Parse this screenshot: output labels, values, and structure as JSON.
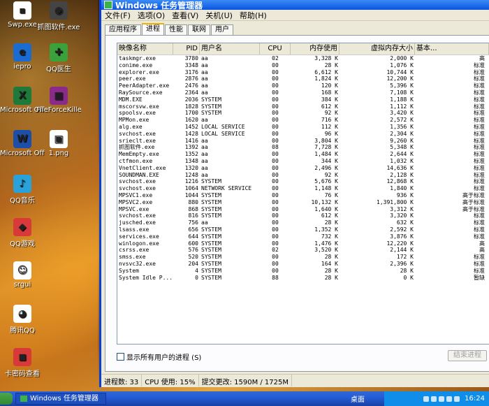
{
  "desktop_icons": [
    {
      "label": "Swp.exe",
      "color": "#ffffff",
      "glyph": "▪"
    },
    {
      "label": "抓图软件.exe",
      "color": "#444444",
      "glyph": "◉"
    },
    {
      "label": "iepro",
      "color": "#1a6cd0",
      "glyph": "e"
    },
    {
      "label": "QQ医生",
      "color": "#3ba23b",
      "glyph": "✚"
    },
    {
      "label": "Microsoft Office Ex...",
      "color": "#1d7a3a",
      "glyph": "X"
    },
    {
      "label": "FileForceKille...",
      "color": "#8a2a8a",
      "glyph": "▦"
    },
    {
      "label": "Microsoft Office W...",
      "color": "#1e4fa8",
      "glyph": "W"
    },
    {
      "label": "1.png",
      "color": "#ffffff",
      "glyph": "▣"
    },
    {
      "label": "QQ音乐",
      "color": "#2aa1d8",
      "glyph": "♪"
    },
    {
      "label": "QQ游戏",
      "color": "#d83a3a",
      "glyph": "◆"
    },
    {
      "label": "srgui",
      "color": "#ffffff",
      "glyph": "☺"
    },
    {
      "label": "腾讯QQ",
      "color": "#ffffff",
      "glyph": "◕"
    },
    {
      "label": "卡密码查看",
      "color": "#d83a3a",
      "glyph": "◼"
    }
  ],
  "window": {
    "title": "Windows 任务管理器",
    "menu": [
      "文件(F)",
      "选项(O)",
      "查看(V)",
      "关机(U)",
      "帮助(H)"
    ],
    "tabs": [
      "应用程序",
      "进程",
      "性能",
      "联网",
      "用户"
    ],
    "columns": [
      "映像名称",
      "PID",
      "用户名",
      "CPU",
      "内存使用",
      "虚拟内存大小",
      "基本..."
    ],
    "rows": [
      [
        "taskmgr.exe",
        "3780",
        "aa",
        "02",
        "3,328 K",
        "2,000 K",
        "高"
      ],
      [
        "conime.exe",
        "3348",
        "aa",
        "00",
        "28 K",
        "1,076 K",
        "标准"
      ],
      [
        "explorer.exe",
        "3176",
        "aa",
        "00",
        "6,612 K",
        "10,744 K",
        "标准"
      ],
      [
        "peer.exe",
        "2876",
        "aa",
        "00",
        "1,824 K",
        "12,200 K",
        "标准"
      ],
      [
        "PeerAdapter.exe",
        "2476",
        "aa",
        "00",
        "120 K",
        "5,396 K",
        "标准"
      ],
      [
        "RaySource.exe",
        "2364",
        "aa",
        "00",
        "168 K",
        "7,108 K",
        "标准"
      ],
      [
        "MDM.EXE",
        "2036",
        "SYSTEM",
        "00",
        "384 K",
        "1,188 K",
        "标准"
      ],
      [
        "mscorsvw.exe",
        "1828",
        "SYSTEM",
        "00",
        "612 K",
        "1,112 K",
        "标准"
      ],
      [
        "spoolsv.exe",
        "1700",
        "SYSTEM",
        "00",
        "92 K",
        "3,420 K",
        "标准"
      ],
      [
        "MPMon.exe",
        "1620",
        "aa",
        "00",
        "716 K",
        "2,572 K",
        "标准"
      ],
      [
        "alg.exe",
        "1452",
        "LOCAL SERVICE",
        "00",
        "112 K",
        "1,356 K",
        "标准"
      ],
      [
        "svchost.exe",
        "1428",
        "LOCAL SERVICE",
        "00",
        "96 K",
        "2,304 K",
        "标准"
      ],
      [
        "srieclt.exe",
        "1416",
        "aa",
        "00",
        "3,804 K",
        "9,260 K",
        "标准"
      ],
      [
        "抓图软件.exe",
        "1392",
        "aa",
        "08",
        "7,728 K",
        "5,348 K",
        "标准"
      ],
      [
        "MemEmpty.exe",
        "1352",
        "aa",
        "00",
        "1,484 K",
        "2,644 K",
        "标准"
      ],
      [
        "ctfmon.exe",
        "1348",
        "aa",
        "00",
        "344 K",
        "1,032 K",
        "标准"
      ],
      [
        "VnetClient.exe",
        "1320",
        "aa",
        "00",
        "2,496 K",
        "14,636 K",
        "标准"
      ],
      [
        "SOUNDMAN.EXE",
        "1248",
        "aa",
        "00",
        "92 K",
        "2,128 K",
        "标准"
      ],
      [
        "svchost.exe",
        "1216",
        "SYSTEM",
        "00",
        "5,676 K",
        "12,868 K",
        "标准"
      ],
      [
        "svchost.exe",
        "1064",
        "NETWORK SERVICE",
        "00",
        "1,148 K",
        "1,840 K",
        "标准"
      ],
      [
        "MPSVC1.exe",
        "1044",
        "SYSTEM",
        "00",
        "76 K",
        "936 K",
        "高于标准"
      ],
      [
        "MPSVC2.exe",
        "880",
        "SYSTEM",
        "00",
        "10,132 K",
        "1,391,800 K",
        "高于标准"
      ],
      [
        "MPSVC.exe",
        "868",
        "SYSTEM",
        "00",
        "1,640 K",
        "3,312 K",
        "高于标准"
      ],
      [
        "svchost.exe",
        "816",
        "SYSTEM",
        "00",
        "612 K",
        "3,320 K",
        "标准"
      ],
      [
        "jusched.exe",
        "756",
        "aa",
        "00",
        "28 K",
        "632 K",
        "标准"
      ],
      [
        "lsass.exe",
        "656",
        "SYSTEM",
        "00",
        "1,352 K",
        "2,592 K",
        "标准"
      ],
      [
        "services.exe",
        "644",
        "SYSTEM",
        "00",
        "732 K",
        "3,876 K",
        "标准"
      ],
      [
        "winlogon.exe",
        "600",
        "SYSTEM",
        "00",
        "1,476 K",
        "12,220 K",
        "高"
      ],
      [
        "csrss.exe",
        "576",
        "SYSTEM",
        "02",
        "3,520 K",
        "2,144 K",
        "高"
      ],
      [
        "smss.exe",
        "520",
        "SYSTEM",
        "00",
        "28 K",
        "172 K",
        "标准"
      ],
      [
        "nvsvc32.exe",
        "204",
        "SYSTEM",
        "00",
        "164 K",
        "2,396 K",
        "标准"
      ],
      [
        "System",
        "4",
        "SYSTEM",
        "00",
        "28 K",
        "28 K",
        "标准"
      ],
      [
        "System Idle P...",
        "0",
        "SYSTEM",
        "88",
        "28 K",
        "0 K",
        "暂缺"
      ]
    ],
    "show_all_users": "显示所有用户的进程 (S)",
    "end_process": "结束进程",
    "status": {
      "processes": "进程数: 33",
      "cpu": "CPU 使用: 15%",
      "commit": "提交更改: 1590M / 1725M"
    }
  },
  "taskbar": {
    "task": "Windows 任务管理器",
    "desktop": "桌面",
    "time": "16:24"
  }
}
